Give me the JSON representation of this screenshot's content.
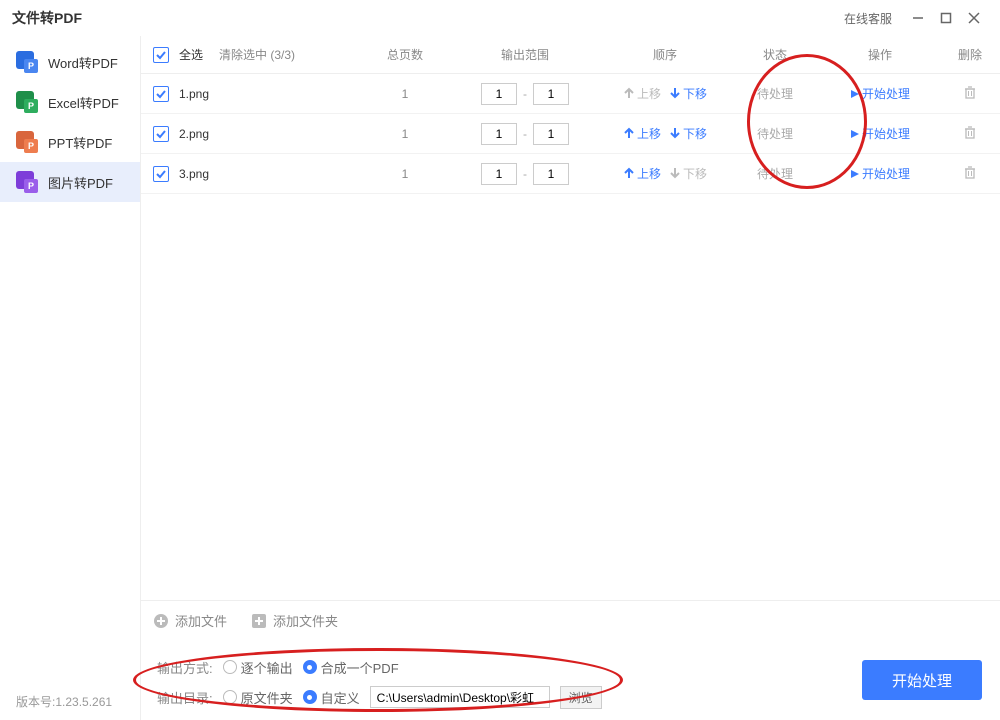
{
  "titlebar": {
    "title": "文件转PDF",
    "support": "在线客服"
  },
  "sidebar": {
    "items": [
      {
        "label": "Word转PDF"
      },
      {
        "label": "Excel转PDF"
      },
      {
        "label": "PPT转PDF"
      },
      {
        "label": "图片转PDF"
      }
    ]
  },
  "header": {
    "select_all": "全选",
    "clear_selected": "清除选中 (3/3)",
    "col_pages": "总页数",
    "col_range": "输出范围",
    "col_order": "顺序",
    "col_status": "状态",
    "col_action": "操作",
    "col_delete": "删除"
  },
  "labels": {
    "move_up": "上移",
    "move_down": "下移",
    "start_item": "开始处理",
    "dash": "-"
  },
  "rows": [
    {
      "name": "1.png",
      "pages": "1",
      "from": "1",
      "to": "1",
      "up_enabled": false,
      "down_enabled": true,
      "status": "待处理"
    },
    {
      "name": "2.png",
      "pages": "1",
      "from": "1",
      "to": "1",
      "up_enabled": true,
      "down_enabled": true,
      "status": "待处理"
    },
    {
      "name": "3.png",
      "pages": "1",
      "from": "1",
      "to": "1",
      "up_enabled": true,
      "down_enabled": false,
      "status": "待处理"
    }
  ],
  "addbar": {
    "add_file": "添加文件",
    "add_folder": "添加文件夹"
  },
  "settings": {
    "output_mode_label": "输出方式:",
    "mode_each": "逐个输出",
    "mode_merge": "合成一个PDF",
    "output_dir_label": "输出目录:",
    "dir_source": "原文件夹",
    "dir_custom": "自定义",
    "path": "C:\\Users\\admin\\Desktop\\彩虹",
    "browse": "浏览"
  },
  "start_button": "开始处理",
  "version": "版本号:1.23.5.261"
}
